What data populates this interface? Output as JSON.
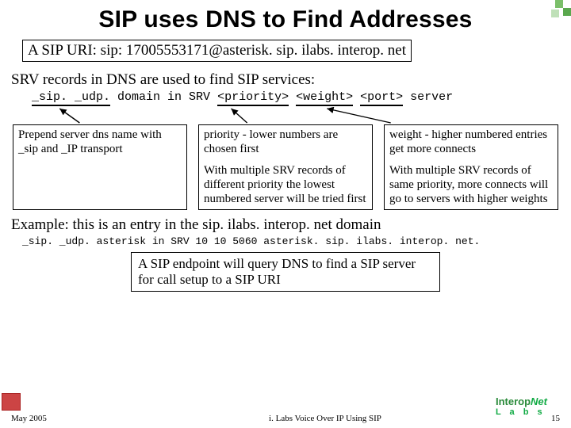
{
  "title": "SIP uses DNS to Find Addresses",
  "uri_line": "A SIP URI:  sip: 17005553171@asterisk. sip. ilabs. interop. net",
  "srv_intro": "SRV records in DNS are used to find SIP services:",
  "srv_template": {
    "seg1": "_sip. _udp.",
    "seg2": " domain in SRV ",
    "seg3": "<priority>",
    "seg4": " ",
    "seg5": "<weight>",
    "seg6": " ",
    "seg7": "<port>",
    "seg8": " server"
  },
  "col1": {
    "p1": "Prepend server dns name with _sip and _IP transport"
  },
  "col2": {
    "p1": "priority - lower numbers are chosen first",
    "p2": "With multiple SRV records of different priority the lowest numbered server will be tried first"
  },
  "col3": {
    "p1": "weight - higher numbered entries get more connects",
    "p2": "With multiple SRV records of same priority, more connects will go to servers with higher weights"
  },
  "example_intro": "Example:  this is an entry in the sip. ilabs. interop. net domain",
  "example_record": "_sip. _udp. asterisk in SRV 10 10 5060 asterisk. sip. ilabs. interop. net.",
  "summary": "A SIP endpoint will query DNS to find a SIP server for call setup to a SIP URI",
  "footer": {
    "date": "May 2005",
    "mid": "i. Labs Voice Over IP Using SIP",
    "page": "15"
  },
  "logo": {
    "brand1": "Interop",
    "brand2": "Net",
    "brand3": "L a b s"
  }
}
